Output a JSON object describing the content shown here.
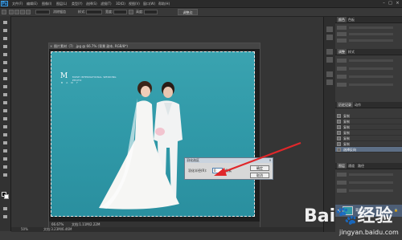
{
  "app": {
    "logo": "Ps"
  },
  "menubar": {
    "items": [
      "文件(F)",
      "编辑(E)",
      "图像(I)",
      "图层(L)",
      "类型(Y)",
      "选择(S)",
      "滤镜(T)",
      "3D(D)",
      "视图(V)",
      "窗口(W)",
      "帮助(H)"
    ],
    "window_controls": [
      "–",
      "□",
      "×"
    ]
  },
  "options_bar": {
    "anti_alias_label": "消除锯齿",
    "style_label": "样式:",
    "width_label": "宽度:",
    "height_label": "高度:",
    "refine_edge_button": "调整边缘..."
  },
  "document": {
    "title": "图片素材（7）.jpg @ 66.7% (背景 副本, RGB/8*)",
    "close": "×",
    "zoom": "66.67%",
    "doc_info": "文档:1.11M/2.22M"
  },
  "photo": {
    "logo_mark": "M",
    "logo_text": "MUSE INTERNATIONAL WEDDING PHOTO",
    "logo_sub": "B A N Y"
  },
  "status": {
    "zoom": "50%",
    "doc_info": "文档:3.23M/6.46M"
  },
  "dialog": {
    "title": "羽化选区",
    "close": "×",
    "feather_label": "羽化半径(R):",
    "feather_value": "0",
    "unit": "像素",
    "ok": "确定",
    "cancel": "取消"
  },
  "panels": {
    "top_tabs": [
      "颜色",
      "色板"
    ],
    "adjust_tabs": [
      "调整",
      "样式"
    ],
    "history_tabs": [
      "历史记录",
      "动作"
    ],
    "history_items": [
      "复制",
      "复制",
      "复制",
      "复制",
      "复制",
      "复制",
      "选择反向"
    ],
    "layers_tabs": [
      "图层",
      "通道",
      "路径"
    ],
    "layer_name": "背景 副本",
    "layer_lock": "🔒",
    "layer_eye": "👁"
  },
  "watermark": {
    "logo": "Bai🐾经验",
    "url": "jingyan.baidu.com"
  },
  "colors": {
    "accent": "#3ea0e6",
    "photo_bg": "#2f98a7",
    "arrow": "#e0272a"
  }
}
